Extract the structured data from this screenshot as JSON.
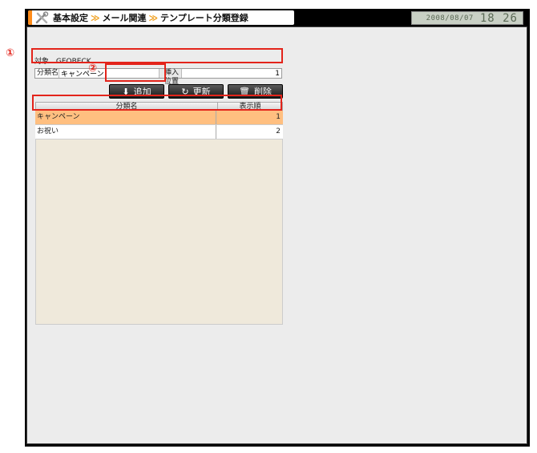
{
  "header": {
    "crumbs": [
      "基本設定",
      "メール関連",
      "テンプレート分類登録"
    ],
    "separator": "≫",
    "date": "2008/08/07",
    "time": "18 26"
  },
  "form": {
    "target_label": "対象",
    "target_value": "GEOBECK",
    "category_label": "分類名",
    "category_value": "キャンペーン",
    "position_label": "挿入位置",
    "position_value": "1"
  },
  "buttons": {
    "add_label": "追加",
    "update_label": "更新",
    "delete_label": "削除"
  },
  "table": {
    "headers": [
      "分類名",
      "表示順"
    ],
    "rows": [
      {
        "name": "キャンペーン",
        "order": "1"
      },
      {
        "name": "お祝い",
        "order": "2"
      }
    ]
  },
  "annotations": {
    "marker1": "①",
    "marker2": "②"
  },
  "colors": {
    "accent": "#ff8c1a",
    "highlight": "#e3241b",
    "selected_row": "#ffbf80"
  }
}
